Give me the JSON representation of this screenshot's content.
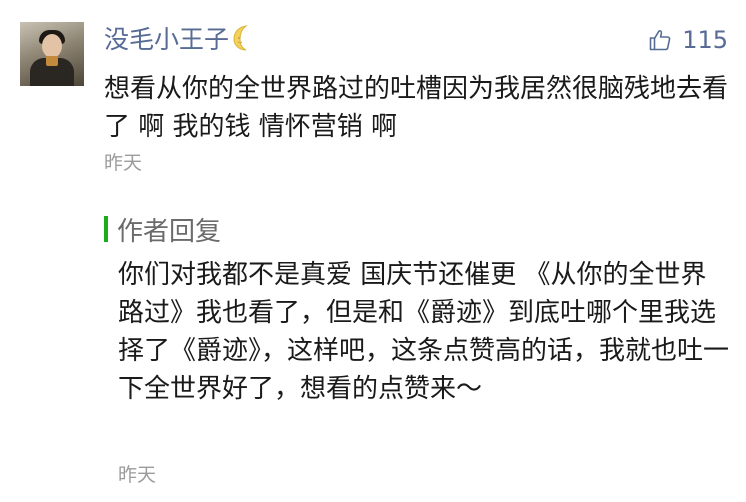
{
  "comment": {
    "username": "没毛小王子",
    "moon_icon": "crescent-moon-emoji",
    "like_icon": "thumbs-up-icon",
    "like_count": "115",
    "text": "想看从你的全世界路过的吐槽因为我居然很脑残地去看了 啊 我的钱 情怀营销 啊",
    "time": "昨天"
  },
  "author_reply": {
    "label": "作者回复",
    "text": "你们对我都不是真爱 国庆节还催更 《从你的全世界路过》我也看了，但是和《爵迹》到底吐哪个里我选择了《爵迹》，这样吧，这条点赞高的话，我就也吐一下全世界好了，想看的点赞来～",
    "time": "昨天"
  },
  "colors": {
    "name_blue": "#576b95",
    "reply_bar_green": "#1aad19",
    "time_gray": "#9b9b9b"
  }
}
